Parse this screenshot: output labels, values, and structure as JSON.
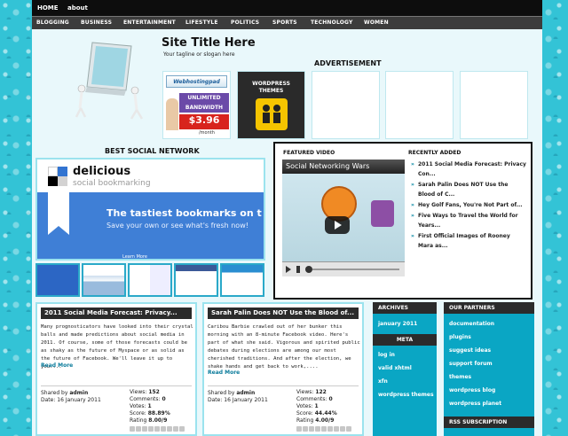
{
  "topnav": {
    "home": "HOME",
    "about": "about"
  },
  "categories": [
    "BLOGGING",
    "BUSINESS",
    "ENTERTAINMENT",
    "LIFESTYLE",
    "POLITICS",
    "SPORTS",
    "TECHNOLOGY",
    "WOMEN"
  ],
  "header": {
    "site_title": "Site Title Here",
    "tagline": "Your tagline or slogan here"
  },
  "ads": {
    "heading": "ADVERTISEMENT",
    "ad1": {
      "brand": "Webhostingpad",
      "line1": "UNLIMITED",
      "line2": "BANDWIDTH",
      "price": "$3.96",
      "unit": "/month"
    },
    "ad2": {
      "line1": "WORDPRESS",
      "line2": "THEMES"
    }
  },
  "best_social": {
    "heading": "BEST SOCIAL NETWORK",
    "name": "delicious",
    "subtitle": "social bookmarking",
    "headline": "The tastiest bookmarks on t",
    "subline": "Save your own or see what's fresh now!",
    "learn": "Learn More"
  },
  "featured_video": {
    "heading": "FEATURED VIDEO",
    "title": "Social Networking Wars"
  },
  "recently_added": {
    "heading": "RECENTLY ADDED",
    "items": [
      "2011 Social Media Forecast: Privacy Con...",
      "Sarah Palin Does NOT Use the Blood of C...",
      "Hey Golf Fans, You're Not Part of...",
      "Five Ways to Travel the World for Years...",
      "First Official Images of Rooney Mara as..."
    ]
  },
  "posts": [
    {
      "title": "2011 Social Media Forecast: Privacy...",
      "body": "Many prognosticators have looked into their crystal balls and made predictions about social media in 2011. Of course, some of those forecasts could be as shaky as the future of Myspace or as solid as the future of Facebook. We'll leave it up to you....",
      "read_more": "Read More",
      "shared_label": "Shared by",
      "author": "admin",
      "date_label": "Date:",
      "date": "16 January 2011",
      "views_label": "Views:",
      "views": "152",
      "comments_label": "Comments:",
      "comments": "0",
      "votes_label": "Votes:",
      "votes": "1",
      "score_label": "Score:",
      "score": "88.89%",
      "rating_label": "Rating",
      "rating": "8.00/9"
    },
    {
      "title": "Sarah Palin Does NOT Use the Blood of...",
      "body": "Caribou Barbie crawled out of her bunker this morning with an 8-minute Facebook video. Here's part of what she said. Vigorous and spirited public debates during elections are among our most cherished traditions. And after the election, we shake hands and get back to work,....",
      "read_more": "Read More",
      "shared_label": "Shared by",
      "author": "admin",
      "date_label": "Date:",
      "date": "16 January 2011",
      "views_label": "Views:",
      "views": "122",
      "comments_label": "Comments:",
      "comments": "0",
      "votes_label": "Votes:",
      "votes": "1",
      "score_label": "Score:",
      "score": "44.44%",
      "rating_label": "Rating",
      "rating": "4.00/9"
    }
  ],
  "archives": {
    "heading": "ARCHIVES",
    "items": [
      "january 2011"
    ]
  },
  "meta": {
    "heading": "META",
    "items": [
      "log in",
      "valid xhtml",
      "xfn",
      "wordpress themes"
    ]
  },
  "partners": {
    "heading": "OUR PARTNERS",
    "items": [
      "documentation",
      "plugins",
      "suggest ideas",
      "support forum",
      "themes",
      "wordpress blog",
      "wordpress planet"
    ]
  },
  "rss": {
    "heading": "RSS SUBSCRIPTION"
  },
  "colors": {
    "accent": "#0aa6c4",
    "dark": "#2b2b2b",
    "page_bg": "#e9f8fb",
    "link": "#0a7b9b"
  }
}
